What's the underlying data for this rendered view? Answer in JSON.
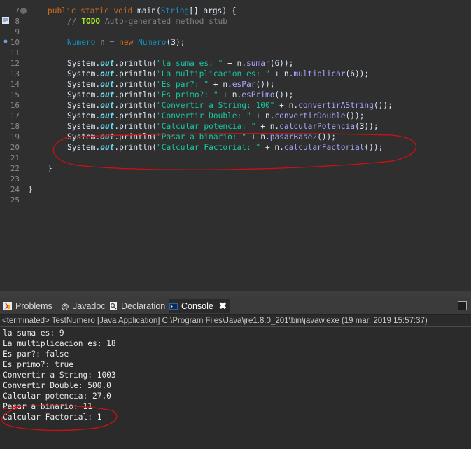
{
  "editor": {
    "lines": [
      {
        "n": "7"
      },
      {
        "n": "8"
      },
      {
        "n": "9"
      },
      {
        "n": "10"
      },
      {
        "n": "11"
      },
      {
        "n": "12"
      },
      {
        "n": "13"
      },
      {
        "n": "14"
      },
      {
        "n": "15"
      },
      {
        "n": "16"
      },
      {
        "n": "17"
      },
      {
        "n": "18"
      },
      {
        "n": "19"
      },
      {
        "n": "20"
      },
      {
        "n": "21"
      },
      {
        "n": "22"
      },
      {
        "n": "23"
      },
      {
        "n": "24"
      },
      {
        "n": "25"
      }
    ],
    "code": {
      "l7": {
        "public": "public",
        "static": "static",
        "void": "void",
        "main": "main",
        "args_open": "(",
        "String": "String",
        "args_rest": "[] args) {"
      },
      "l8": {
        "prefix": "// ",
        "todo": "TODO",
        "rest": " Auto-generated method stub"
      },
      "l10": {
        "type": "Numero",
        "mid": " n = ",
        "new": "new",
        "ctor": " Numero",
        "rest": "(3);"
      },
      "calls": [
        {
          "str": "\"la suma es: \"",
          "plus": " + n.",
          "method": "sumar",
          "rest": "(6));"
        },
        {
          "str": "\"La multiplicacion es: \"",
          "plus": " + n.",
          "method": "multiplicar",
          "rest": "(6));"
        },
        {
          "str": "\"Es par?: \"",
          "plus": " + n.",
          "method": "esPar",
          "rest": "());"
        },
        {
          "str": "\"Es primo?: \"",
          "plus": " + n.",
          "method": "esPrimo",
          "rest": "());"
        },
        {
          "str": "\"Convertir a String: 100\"",
          "plus": " + n.",
          "method": "convertirAString",
          "rest": "());"
        },
        {
          "str": "\"Convertir Double: \"",
          "plus": " + n.",
          "method": "convertirDouble",
          "rest": "());"
        },
        {
          "str": "\"Calcular potencia: \"",
          "plus": " + n.",
          "method": "calcularPotencia",
          "rest": "(3));"
        },
        {
          "str": "\"Pasar a binario: \"",
          "plus": " + n.",
          "method": "pasarBase2",
          "rest": "());"
        },
        {
          "str": "\"Calcular Factorial: \"",
          "plus": " + n.",
          "method": "calcularFactorial",
          "rest": "());"
        }
      ],
      "system": "System",
      "out": "out",
      "println": "println(",
      "dot": ".",
      "close_brace": "}"
    }
  },
  "tabs": [
    {
      "label": "Problems",
      "icon": "problems-icon"
    },
    {
      "label": "Javadoc",
      "icon": "javadoc-icon"
    },
    {
      "label": "Declaration",
      "icon": "declaration-icon"
    },
    {
      "label": "Console",
      "icon": "console-icon"
    }
  ],
  "console": {
    "terminated": "<terminated> TestNumero [Java Application] C:\\Program Files\\Java\\jre1.8.0_201\\bin\\javaw.exe (19 mar. 2019 15:57:37)",
    "output": [
      "la suma es: 9",
      "La multiplicacion es: 18",
      "Es par?: false",
      "Es primo?: true",
      "Convertir a String: 1003",
      "Convertir Double: 500.0",
      "Calcular potencia: 27.0",
      "Pasar a binario: 11",
      "Calcular Factorial: 1"
    ]
  },
  "colors": {
    "annotation": "#d01010",
    "background": "#2f2f2f"
  }
}
